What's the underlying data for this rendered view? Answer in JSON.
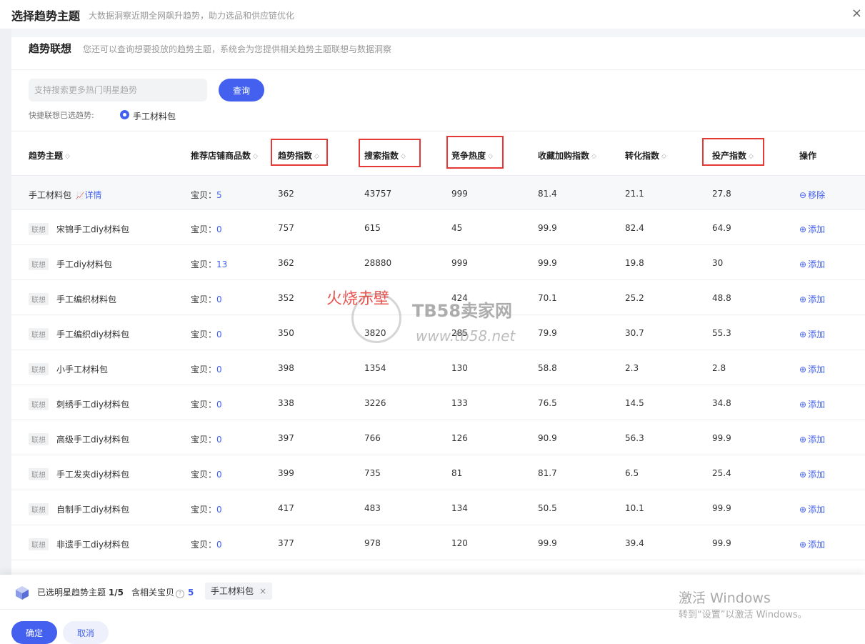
{
  "header": {
    "title": "选择趋势主题",
    "subtitle": "大数据洞察近期全网飙升趋势，助力选品和供应链优化",
    "close": "×"
  },
  "section": {
    "title": "趋势联想",
    "desc": "您还可以查询想要投放的趋势主题，系统会为您提供相关趋势主题联想与数据洞察"
  },
  "search": {
    "placeholder": "支持搜索更多热门明星趋势",
    "value": "",
    "button": "查询"
  },
  "quick": {
    "label": "快捷联想已选趋势:",
    "option": "手工材料包"
  },
  "columns": {
    "theme": "趋势主题",
    "count": "推荐店铺商品数",
    "trend": "趋势指数",
    "search": "搜索指数",
    "competition": "竞争热度",
    "fav": "收藏加购指数",
    "conversion": "转化指数",
    "roi": "投产指数",
    "op": "操作",
    "sort_icon": "◇"
  },
  "badge_text": "联想",
  "detail_link": "详情",
  "count_prefix": "宝贝：",
  "rows": [
    {
      "name": "手工材料包",
      "count": "5",
      "trend": "362",
      "search": "43757",
      "competition": "999",
      "fav": "81.4",
      "conversion": "21.1",
      "roi": "27.8",
      "action": "移除",
      "action_icon": "⊖"
    },
    {
      "name": "宋锦手工diy材料包",
      "count": "0",
      "trend": "757",
      "search": "615",
      "competition": "45",
      "fav": "99.9",
      "conversion": "82.4",
      "roi": "64.9",
      "action": "添加",
      "action_icon": "⊕"
    },
    {
      "name": "手工diy材料包",
      "count": "13",
      "trend": "362",
      "search": "28880",
      "competition": "999",
      "fav": "99.9",
      "conversion": "19.8",
      "roi": "30",
      "action": "添加",
      "action_icon": "⊕"
    },
    {
      "name": "手工编织材料包",
      "count": "0",
      "trend": "352",
      "search": "",
      "competition": "424",
      "fav": "70.1",
      "conversion": "25.2",
      "roi": "48.8",
      "action": "添加",
      "action_icon": "⊕"
    },
    {
      "name": "手工编织diy材料包",
      "count": "0",
      "trend": "350",
      "search": "3820",
      "competition": "285",
      "fav": "79.9",
      "conversion": "30.7",
      "roi": "55.3",
      "action": "添加",
      "action_icon": "⊕"
    },
    {
      "name": "小手工材料包",
      "count": "0",
      "trend": "398",
      "search": "1354",
      "competition": "130",
      "fav": "58.8",
      "conversion": "2.3",
      "roi": "2.8",
      "action": "添加",
      "action_icon": "⊕"
    },
    {
      "name": "刺绣手工diy材料包",
      "count": "0",
      "trend": "338",
      "search": "3226",
      "competition": "133",
      "fav": "76.5",
      "conversion": "14.5",
      "roi": "34.8",
      "action": "添加",
      "action_icon": "⊕"
    },
    {
      "name": "高级手工diy材料包",
      "count": "0",
      "trend": "397",
      "search": "766",
      "competition": "126",
      "fav": "90.9",
      "conversion": "56.3",
      "roi": "99.9",
      "action": "添加",
      "action_icon": "⊕"
    },
    {
      "name": "手工发夹diy材料包",
      "count": "0",
      "trend": "399",
      "search": "735",
      "competition": "81",
      "fav": "81.7",
      "conversion": "6.5",
      "roi": "25.4",
      "action": "添加",
      "action_icon": "⊕"
    },
    {
      "name": "自制手工diy材料包",
      "count": "0",
      "trend": "417",
      "search": "483",
      "competition": "134",
      "fav": "50.5",
      "conversion": "10.1",
      "roi": "99.9",
      "action": "添加",
      "action_icon": "⊕"
    },
    {
      "name": "非遗手工diy材料包",
      "count": "0",
      "trend": "377",
      "search": "978",
      "competition": "120",
      "fav": "99.9",
      "conversion": "39.4",
      "roi": "99.9",
      "action": "添加",
      "action_icon": "⊕"
    }
  ],
  "watermark": {
    "cn": "火烧赤壁",
    "brand": "TB58卖家网",
    "url": "www.tb58.net"
  },
  "footer": {
    "selected_label": "已选明星趋势主题",
    "selected_count": "1/5",
    "items_label": "含相关宝贝",
    "help": "?",
    "items_count": "5",
    "tag": "手工材料包",
    "tag_close": "×",
    "ok": "确定",
    "cancel": "取消"
  },
  "windows": {
    "line1": "激活 Windows",
    "line2": "转到“设置”以激活 Windows。"
  },
  "colors": {
    "accent": "#4361ee",
    "highlight": "#e53935"
  }
}
